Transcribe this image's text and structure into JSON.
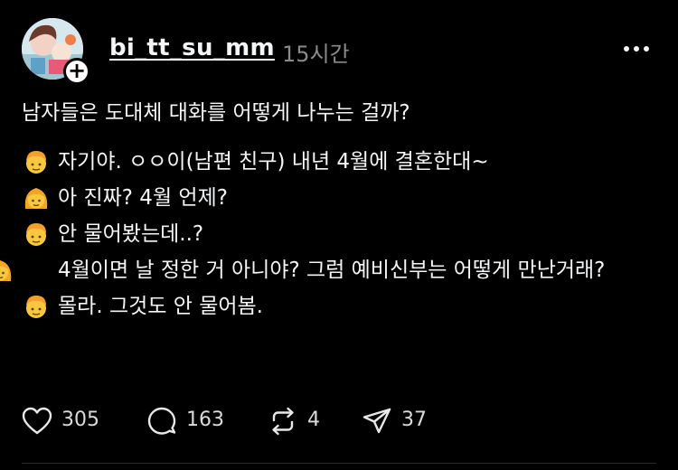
{
  "post": {
    "username": "bi_tt_su_mm",
    "timestamp": "15시간",
    "lines": [
      {
        "speaker_icon": "man-emoji",
        "text": "남자들은 도대체 대화를 어떻게 나누는 걸까?"
      },
      {
        "speaker_icon": "man-emoji",
        "text": "자기야. ㅇㅇ이(남편 친구) 내년 4월에 결혼한대~"
      },
      {
        "speaker_icon": "woman-emoji",
        "text": "아 진짜? 4월 언제?"
      },
      {
        "speaker_icon": "man-emoji",
        "text": "안 물어봤는데..?"
      },
      {
        "speaker_icon": "woman-emoji",
        "text": "4월이면 날 정한 거 아니야? 그럼 예비신부는 어떻게 만난거래?"
      },
      {
        "speaker_icon": "man-emoji",
        "text": "몰라. 그것도 안 물어봄."
      }
    ],
    "stats": {
      "likes": "305",
      "replies": "163",
      "reposts": "4",
      "shares": "37"
    }
  },
  "colors": {
    "background": "#000000",
    "text": "#f3f5f7",
    "muted": "#8a8a8a"
  }
}
